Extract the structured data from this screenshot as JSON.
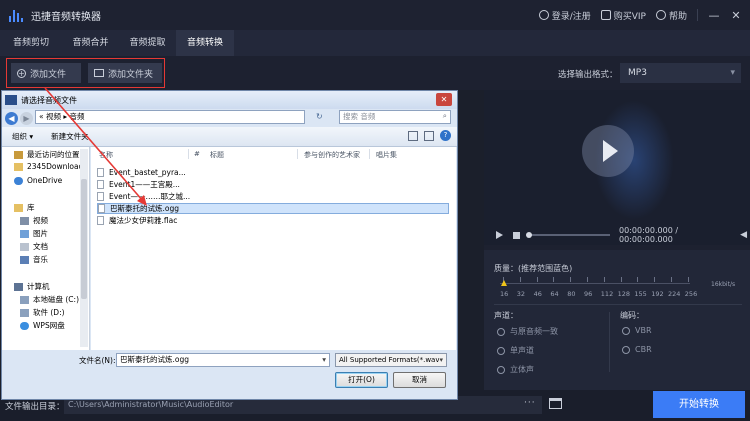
{
  "app": {
    "title": "迅捷音频转换器",
    "login": "登录/注册",
    "vip": "购买VIP",
    "help": "帮助",
    "minimize": "—",
    "close": "✕"
  },
  "tabs": [
    "音频剪切",
    "音频合并",
    "音频提取",
    "音频转换"
  ],
  "active_tab": "音频转换",
  "toolbar": {
    "add_file": "添加文件",
    "add_folder": "添加文件夹",
    "format_label": "选择输出格式：",
    "format_value": "MP3",
    "highlight_color": "#e53935"
  },
  "player": {
    "time": "00:00:00.000 / 00:00:00.000"
  },
  "settings": {
    "quality_label": "质量：(推荐范围蓝色)",
    "quality_values": [
      "16",
      "32",
      "46",
      "64",
      "80",
      "96",
      "112",
      "128",
      "155",
      "192",
      "224",
      "256"
    ],
    "quality_unit": "16kbit/s",
    "channel_label": "声道：",
    "channel_options": [
      "与原音频一致",
      "单声道",
      "立体声"
    ],
    "encoding_label": "编码：",
    "encoding_options": [
      "VBR",
      "CBR"
    ]
  },
  "bottom": {
    "output_label": "文件输出目录：",
    "output_path": "C:\\Users\\Administrator\\Music\\AudioEditor",
    "browse": "···",
    "start": "开始转换",
    "accent": "#3b7cf6"
  },
  "dialog": {
    "title": "请选择音频文件",
    "address": "« 视频 ▸ 音频",
    "search_placeholder": "搜索 音频",
    "organize": "组织 ▾",
    "new_folder": "新建文件夹",
    "nav_items": [
      "最近访问的位置",
      "2345Downloads",
      "OneDrive",
      "库",
      "视频",
      "图片",
      "文档",
      "音乐",
      "计算机",
      "本地磁盘 (C:)",
      "软件 (D:)",
      "WPS网盘"
    ],
    "columns": [
      "名称",
      "#",
      "标题",
      "参与创作的艺术家",
      "唱片集"
    ],
    "files": [
      "Event_bastet_pyra...",
      "Event1——王宫殿...",
      "Event——……耶之城...",
      "巴斯泰托的试炼.ogg",
      "魔法少女伊莉雅.flac"
    ],
    "selected_index": 3,
    "filename_label": "文件名(N):",
    "filename_value": "巴斯泰托的试炼.ogg",
    "filetype": "All Supported Formats(*.wav",
    "open": "打开(O)",
    "cancel": "取消"
  }
}
